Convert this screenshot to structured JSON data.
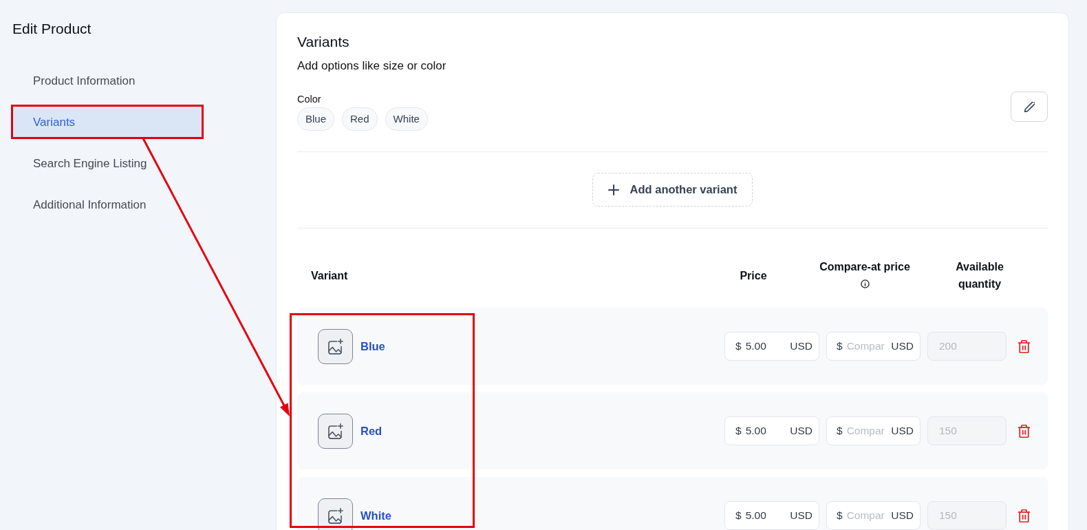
{
  "sidebar": {
    "title": "Edit Product",
    "items": [
      {
        "label": "Product Information",
        "selected": false
      },
      {
        "label": "Variants",
        "selected": true
      },
      {
        "label": "Search Engine Listing",
        "selected": false
      },
      {
        "label": "Additional Information",
        "selected": false
      }
    ]
  },
  "variants": {
    "title": "Variants",
    "subtitle": "Add options like size or color",
    "options": [
      {
        "name": "Color",
        "values": [
          "Blue",
          "Red",
          "White"
        ]
      }
    ],
    "add_button": "Add another variant",
    "table": {
      "columns": [
        {
          "label": "Variant",
          "info": false
        },
        {
          "label": "Price",
          "info": false
        },
        {
          "label": "Compare-at price",
          "info": true
        },
        {
          "label": "Available quantity",
          "info": false
        }
      ],
      "rows": [
        {
          "name": "Blue",
          "price": {
            "prefix": "$",
            "value": "5.00",
            "suffix": "USD"
          },
          "compare_at": {
            "prefix": "$",
            "placeholder": "Compar",
            "suffix": "USD"
          },
          "quantity": {
            "value": "200",
            "disabled": true
          }
        },
        {
          "name": "Red",
          "price": {
            "prefix": "$",
            "value": "5.00",
            "suffix": "USD"
          },
          "compare_at": {
            "prefix": "$",
            "placeholder": "Compar",
            "suffix": "USD"
          },
          "quantity": {
            "value": "150",
            "disabled": true
          }
        },
        {
          "name": "White",
          "price": {
            "prefix": "$",
            "value": "5.00",
            "suffix": "USD"
          },
          "compare_at": {
            "prefix": "$",
            "placeholder": "Compar",
            "suffix": "USD"
          },
          "quantity": {
            "value": "150",
            "disabled": true
          }
        }
      ]
    }
  },
  "annotations": [
    {
      "kind": "frame"
    },
    {
      "kind": "frame"
    },
    {
      "kind": "arrow"
    }
  ]
}
